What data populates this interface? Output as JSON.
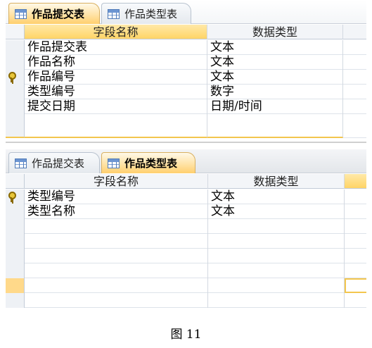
{
  "top_window": {
    "tabs": [
      {
        "label": "作品提交表",
        "active": true
      },
      {
        "label": "作品类型表",
        "active": false
      }
    ],
    "columns": [
      "字段名称",
      "数据类型"
    ],
    "rows": [
      {
        "field": "作品提交表",
        "type": "文本",
        "primary_key": false
      },
      {
        "field": "作品名称",
        "type": "文本",
        "primary_key": false
      },
      {
        "field": "作品编号",
        "type": "文本",
        "primary_key": true
      },
      {
        "field": "类型编号",
        "type": "数字",
        "primary_key": false
      },
      {
        "field": "提交日期",
        "type": "日期/时间",
        "primary_key": false
      }
    ]
  },
  "bottom_window": {
    "tabs": [
      {
        "label": "作品提交表",
        "active": false
      },
      {
        "label": "作品类型表",
        "active": true
      }
    ],
    "columns": [
      "字段名称",
      "数据类型"
    ],
    "rows": [
      {
        "field": "类型编号",
        "type": "文本",
        "primary_key": true
      },
      {
        "field": "类型名称",
        "type": "文本",
        "primary_key": false
      }
    ]
  },
  "caption": "图 11",
  "colors": {
    "active_tab": "#ffd466",
    "key_icon": "#e8c63a",
    "grid_line": "#d3d9e1"
  }
}
